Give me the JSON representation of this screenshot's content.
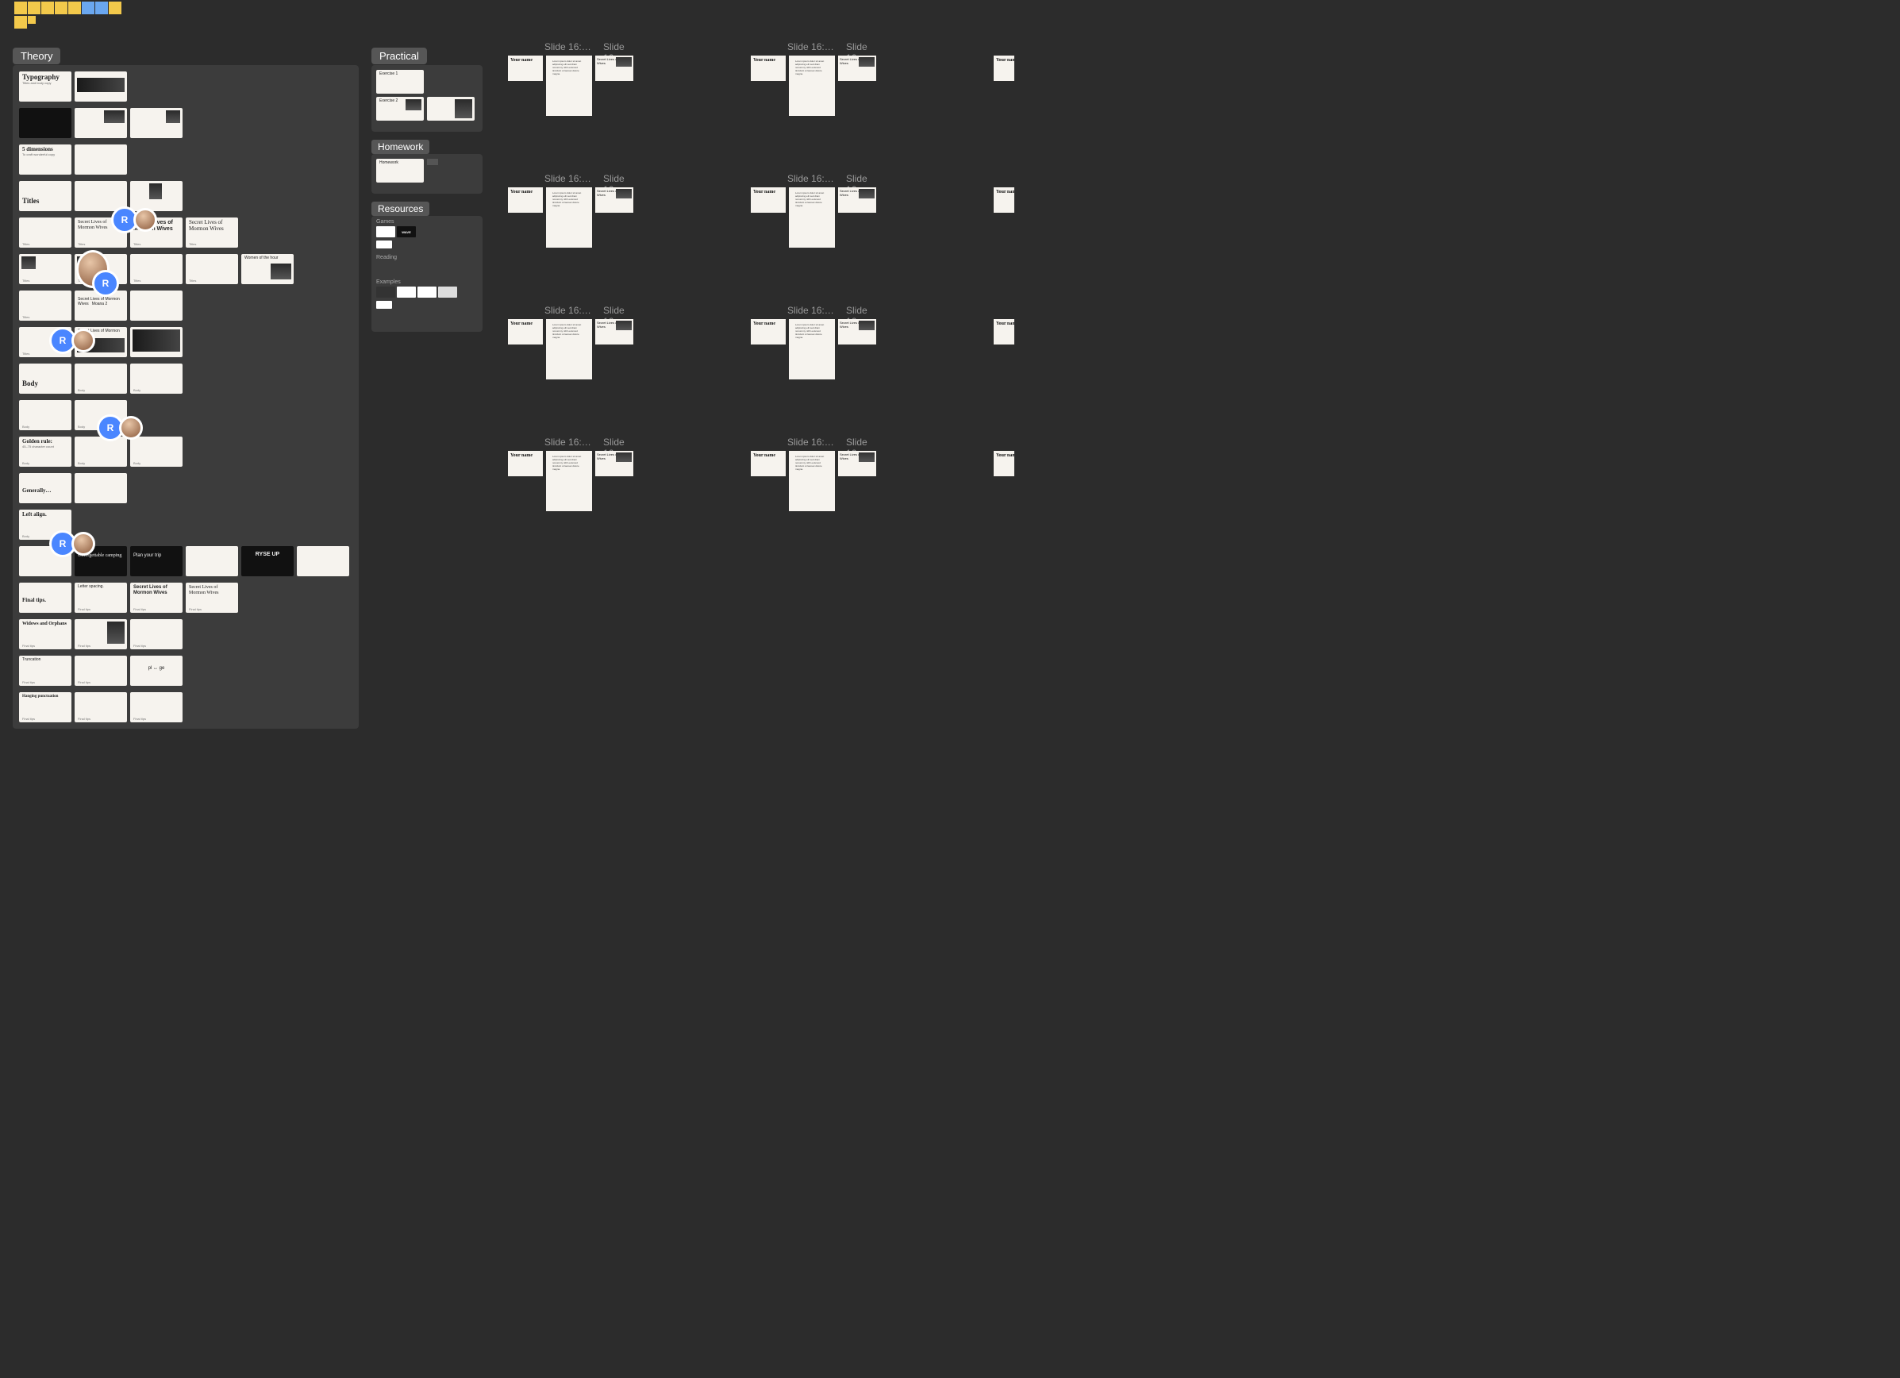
{
  "stickies": {
    "top_colors": [
      "#f3c94b",
      "#f3c94b",
      "#f3c94b",
      "#f3c94b",
      "#f3c94b",
      "#6aa7f0",
      "#6aa7f0",
      "#f3c94b"
    ],
    "bottom_colors": [
      "#f3c94b",
      "#f3c94b"
    ]
  },
  "sections": {
    "theory": "Theory",
    "practical": "Practical",
    "homework": "Homework",
    "resources": "Resources"
  },
  "presence": {
    "letter": "R"
  },
  "theory_slides": {
    "typography_title": "Typography",
    "typography_sub": "Titles and body copy",
    "five_dim": "5 dimensions",
    "five_dim_sub": "To craft wonderful copy",
    "titles": "Titles",
    "sl_serif": "Secret Lives of Mormon Wives",
    "sl_bold": "Secret Lives of Mormon Wives",
    "sl_light": "Secret Lives of Mormon Wives",
    "moana": "Moana 2",
    "women": "Women of the hour",
    "body": "Body",
    "golden": "Golden rule:",
    "golden_sub": "45–75 character count",
    "generally": "Generally…",
    "left_align": "Left align.",
    "camping": "Unforgettable camping",
    "plan_trip": "Plan your trip",
    "ryse": "RYSE UP",
    "final_tips": "Final tips.",
    "letter_spacing": "Letter spacing.",
    "widows": "Widows and Orphans",
    "truncation": "Truncation",
    "pl_ge": "pl ↔ ge",
    "hanging": "Hanging punctuation",
    "footer_titles": "Titles",
    "footer_body": "Body",
    "footer_final": "Final tips"
  },
  "practical": {
    "ex1": "Exercise 1",
    "ex2": "Exercise 2"
  },
  "homework": {
    "h1": "Homework"
  },
  "resources": {
    "games": "Games",
    "reading": "Reading",
    "examples": "Examples",
    "wave": "WAVE"
  },
  "frames": {
    "title": "Slide 16:…",
    "your_name": "Your name",
    "pageC_text": "Secret Lives of Mormon Wives",
    "body_filler": "Lorem ipsum dolor sit amet adipiscing elit sed diam nonummy nibh euismod tincidunt ut laoreet dolore magna."
  }
}
